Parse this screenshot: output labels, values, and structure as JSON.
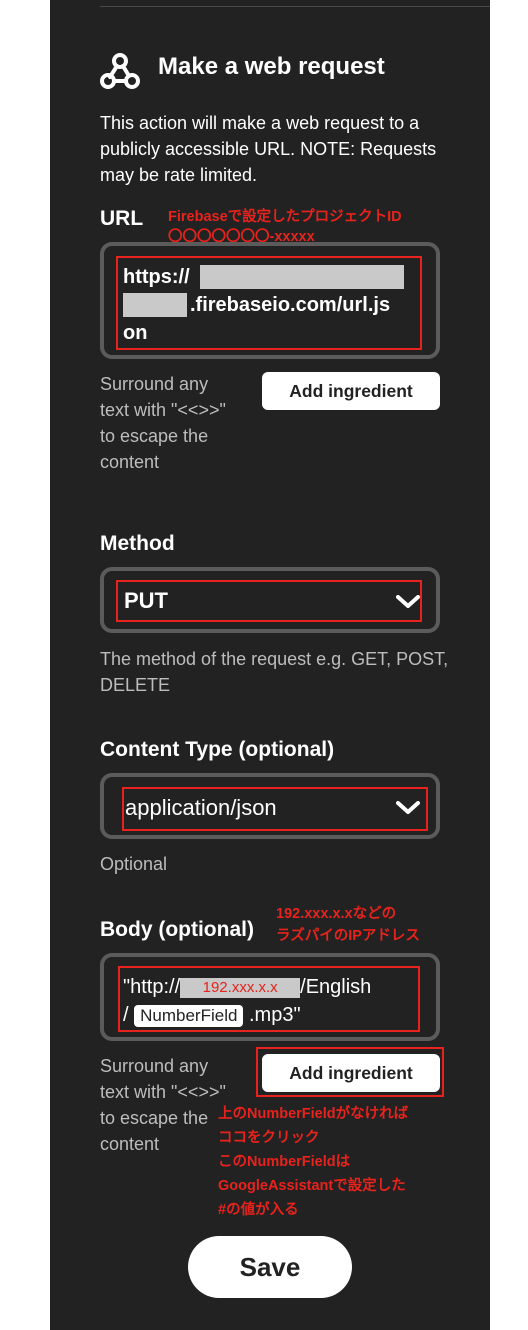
{
  "header": {
    "title": "Make a web request",
    "icon": "webhook-icon"
  },
  "description": "This action will make a web request to a publicly accessible URL. NOTE: Requests may be rate limited.",
  "url": {
    "label": "URL",
    "note_line1": "Firebaseで設定したプロジェクトID",
    "note_line2": "〇〇〇〇〇〇〇-xxxxx",
    "line1": "https://",
    "line2": ".firebaseio.com/url.js",
    "line3": "on",
    "helper": "Surround any text with \"<<>>\" to escape the content",
    "add_ingredient": "Add ingredient"
  },
  "method": {
    "label": "Method",
    "value": "PUT",
    "helper": "The method of the request e.g. GET, POST, DELETE"
  },
  "content_type": {
    "label": "Content Type (optional)",
    "value": "application/json",
    "helper": "Optional"
  },
  "body": {
    "label": "Body (optional)",
    "note_line1": "192.xxx.x.xなどの",
    "note_line2": "ラズパイのIPアドレス",
    "prefix": "\"http://",
    "ip_placeholder": "192.xxx.x.x",
    "after_ip": "/English",
    "slash": "/",
    "ingredient": "NumberField",
    "suffix": ".mp3\"",
    "helper": "Surround any text with \"<<>>\" to escape the content",
    "add_ingredient": "Add ingredient",
    "note2_line1": "上のNumberFieldがなければ",
    "note2_line2": "ココをクリック",
    "note2_line3": "このNumberFieldは",
    "note2_line4": "GoogleAssistantで設定した",
    "note2_line5": "#の値が入る"
  },
  "save_label": "Save",
  "colors": {
    "panel": "#222222",
    "annotation_red": "#e8221c",
    "field_border": "#5b5b5b"
  }
}
